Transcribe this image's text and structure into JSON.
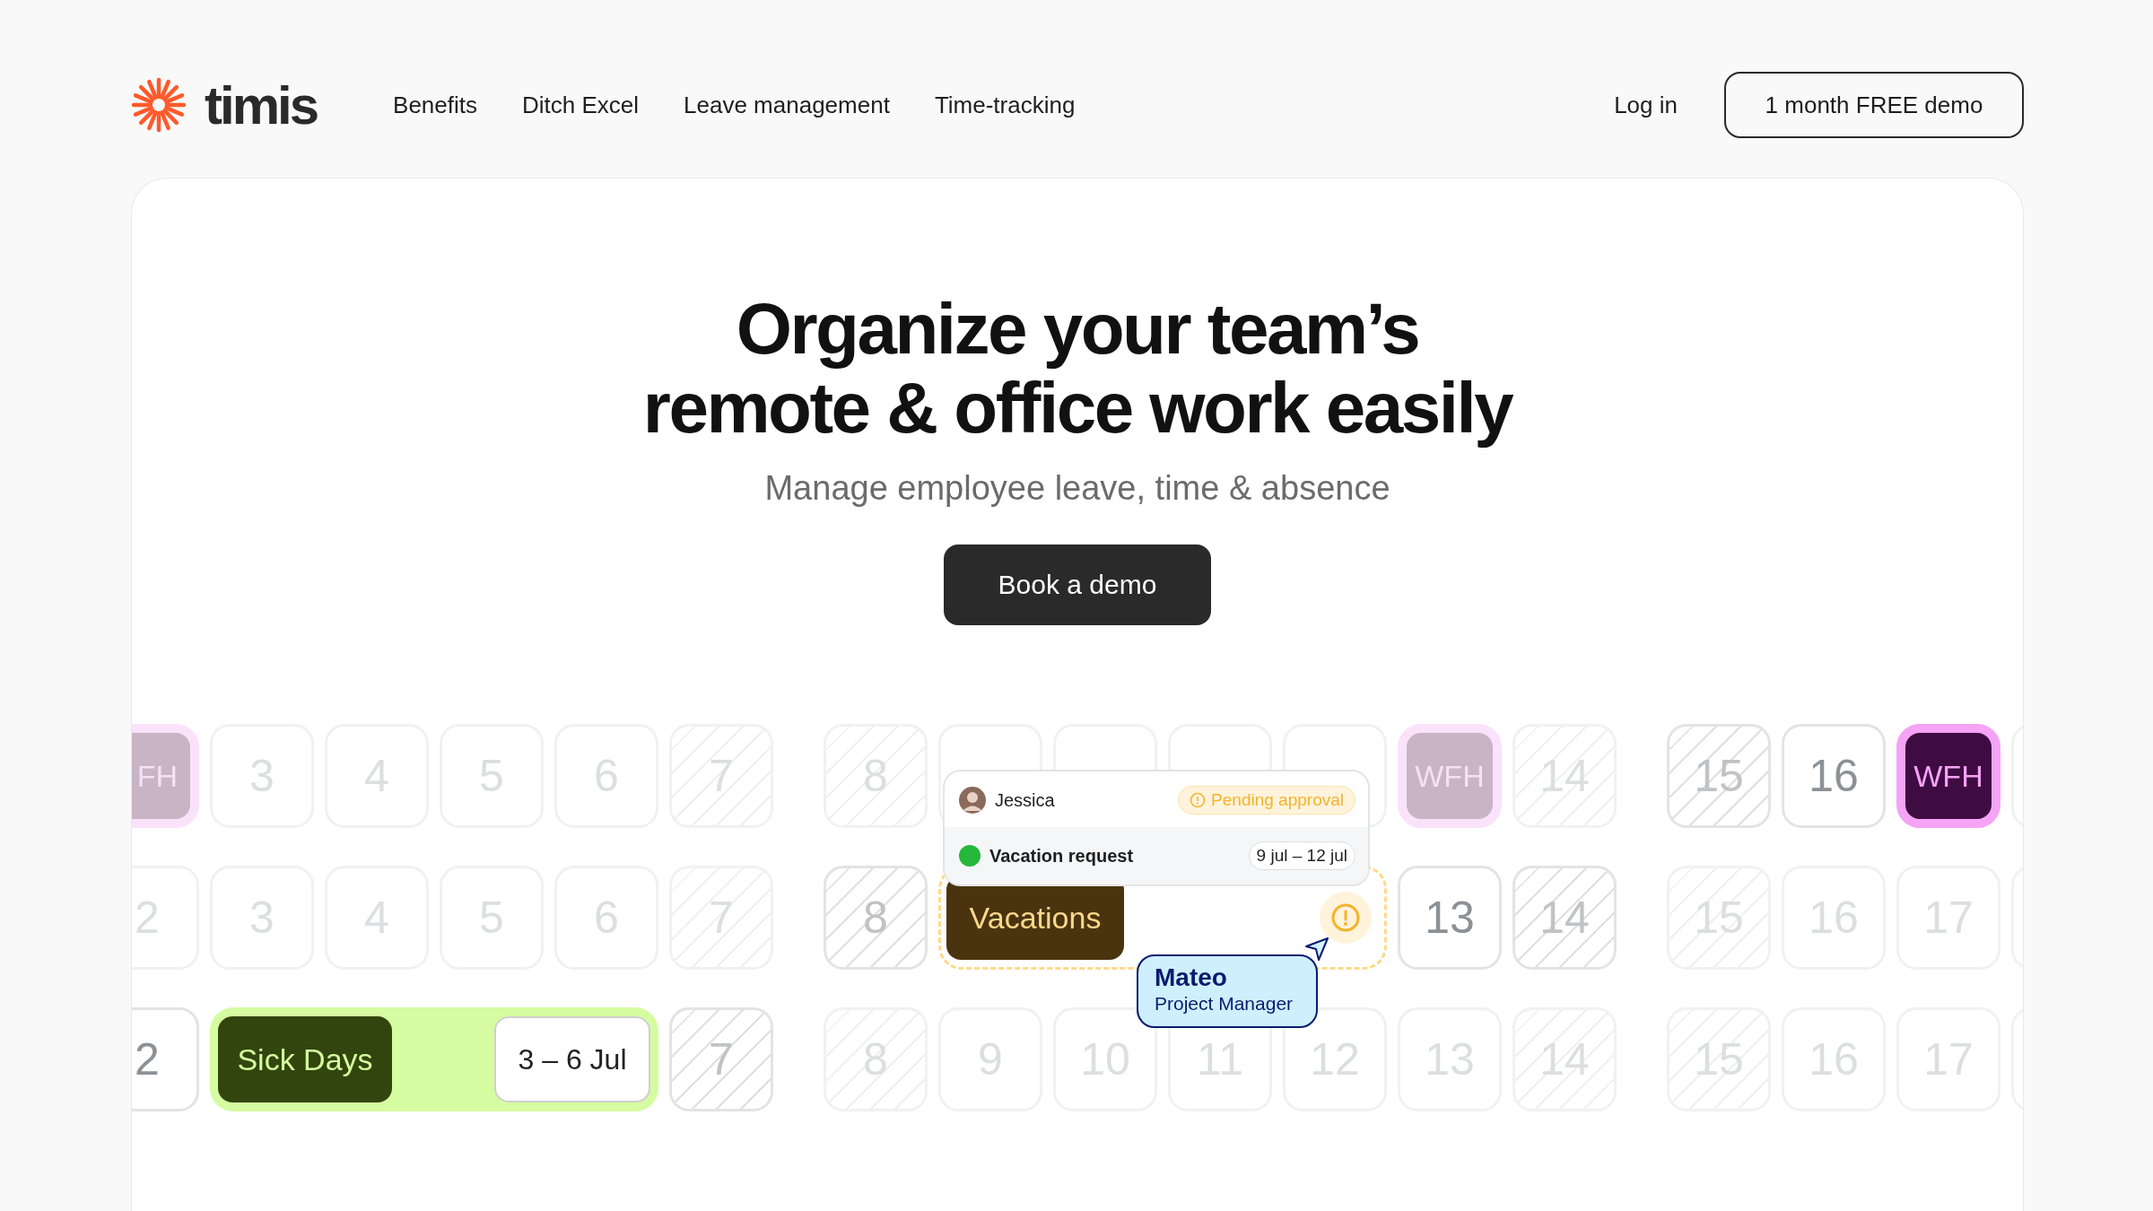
{
  "header": {
    "logo": {
      "wordmark": "timis"
    },
    "nav": [
      {
        "label": "Benefits"
      },
      {
        "label": "Ditch Excel"
      },
      {
        "label": "Leave management"
      },
      {
        "label": "Time-tracking"
      }
    ],
    "login": "Log in",
    "cta": "1 month FREE demo"
  },
  "hero": {
    "title_lines": [
      "Organize your team’s",
      "remote & office work easily"
    ],
    "subtitle": "Manage employee leave, time & absence",
    "button": "Book a demo"
  },
  "calendar": {
    "rows": [
      {
        "weeks": [
          [
            {
              "kind": "wfh",
              "day": "FH",
              "highlighted": false
            },
            {
              "kind": "day",
              "day": "3",
              "hatched": false,
              "highlighted": false
            },
            {
              "kind": "day",
              "day": "4",
              "hatched": false,
              "highlighted": false
            },
            {
              "kind": "day",
              "day": "5",
              "hatched": false,
              "highlighted": false
            },
            {
              "kind": "day",
              "day": "6",
              "hatched": false,
              "highlighted": false
            },
            {
              "kind": "day",
              "day": "7",
              "hatched": true,
              "highlighted": false
            }
          ],
          [
            {
              "kind": "day",
              "day": "8",
              "hatched": true,
              "highlighted": false
            },
            {
              "kind": "day",
              "hatched": false,
              "highlighted": false
            },
            {
              "kind": "day",
              "hatched": false,
              "highlighted": false
            },
            {
              "kind": "day",
              "hatched": false,
              "highlighted": false
            },
            {
              "kind": "day",
              "hatched": false,
              "highlighted": false
            },
            {
              "kind": "wfh",
              "day": "WFH",
              "highlighted": false
            },
            {
              "kind": "day",
              "day": "14",
              "hatched": true,
              "highlighted": false
            }
          ],
          [
            {
              "kind": "day",
              "day": "15",
              "hatched": true,
              "highlighted": true
            },
            {
              "kind": "day",
              "day": "16",
              "hatched": false,
              "highlighted": true
            },
            {
              "kind": "wfh",
              "day": "WFH",
              "highlighted": true
            },
            {
              "kind": "day",
              "hatched": false,
              "highlighted": false
            }
          ]
        ]
      },
      {
        "weeks": [
          [
            {
              "kind": "day",
              "day": "2",
              "hatched": false,
              "highlighted": false
            },
            {
              "kind": "day",
              "day": "3",
              "hatched": false,
              "highlighted": false
            },
            {
              "kind": "day",
              "day": "4",
              "hatched": false,
              "highlighted": false
            },
            {
              "kind": "day",
              "day": "5",
              "hatched": false,
              "highlighted": false
            },
            {
              "kind": "day",
              "day": "6",
              "hatched": false,
              "highlighted": false
            },
            {
              "kind": "day",
              "day": "7",
              "hatched": true,
              "highlighted": false
            }
          ],
          [
            {
              "kind": "day",
              "day": "8",
              "hatched": true,
              "highlighted": true
            },
            {
              "kind": "vacation",
              "label": "Vacations"
            },
            {
              "kind": "day",
              "day": "13",
              "hatched": false,
              "highlighted": true
            },
            {
              "kind": "day",
              "day": "14",
              "hatched": true,
              "highlighted": true
            }
          ],
          [
            {
              "kind": "day",
              "day": "15",
              "hatched": true,
              "highlighted": false
            },
            {
              "kind": "day",
              "day": "16",
              "hatched": false,
              "highlighted": false
            },
            {
              "kind": "day",
              "day": "17",
              "hatched": false,
              "highlighted": false
            },
            {
              "kind": "day",
              "hatched": false,
              "highlighted": false
            }
          ]
        ]
      },
      {
        "weeks": [
          [
            {
              "kind": "day",
              "day": "2",
              "hatched": false,
              "highlighted": true
            },
            {
              "kind": "sick",
              "label": "Sick Days",
              "dates": "3 – 6 Jul"
            },
            {
              "kind": "day",
              "day": "7",
              "hatched": true,
              "highlighted": true
            }
          ],
          [
            {
              "kind": "day",
              "day": "8",
              "hatched": true,
              "highlighted": false
            },
            {
              "kind": "day",
              "day": "9",
              "hatched": false,
              "highlighted": false
            },
            {
              "kind": "day",
              "day": "10",
              "hatched": false,
              "highlighted": false
            },
            {
              "kind": "day",
              "day": "11",
              "hatched": false,
              "highlighted": false
            },
            {
              "kind": "day",
              "day": "12",
              "hatched": false,
              "highlighted": false
            },
            {
              "kind": "day",
              "day": "13",
              "hatched": false,
              "highlighted": false
            },
            {
              "kind": "day",
              "day": "14",
              "hatched": true,
              "highlighted": false
            }
          ],
          [
            {
              "kind": "day",
              "day": "15",
              "hatched": true,
              "highlighted": false
            },
            {
              "kind": "day",
              "day": "16",
              "hatched": false,
              "highlighted": false
            },
            {
              "kind": "day",
              "day": "17",
              "hatched": false,
              "highlighted": false
            },
            {
              "kind": "day",
              "hatched": false,
              "highlighted": false
            }
          ]
        ]
      }
    ],
    "request": {
      "person": "Jessica",
      "status": "Pending approval",
      "type": "Vacation request",
      "dates": "9 jul – 12 jul"
    },
    "tooltip": {
      "name": "Mateo",
      "role": "Project Manager"
    }
  }
}
